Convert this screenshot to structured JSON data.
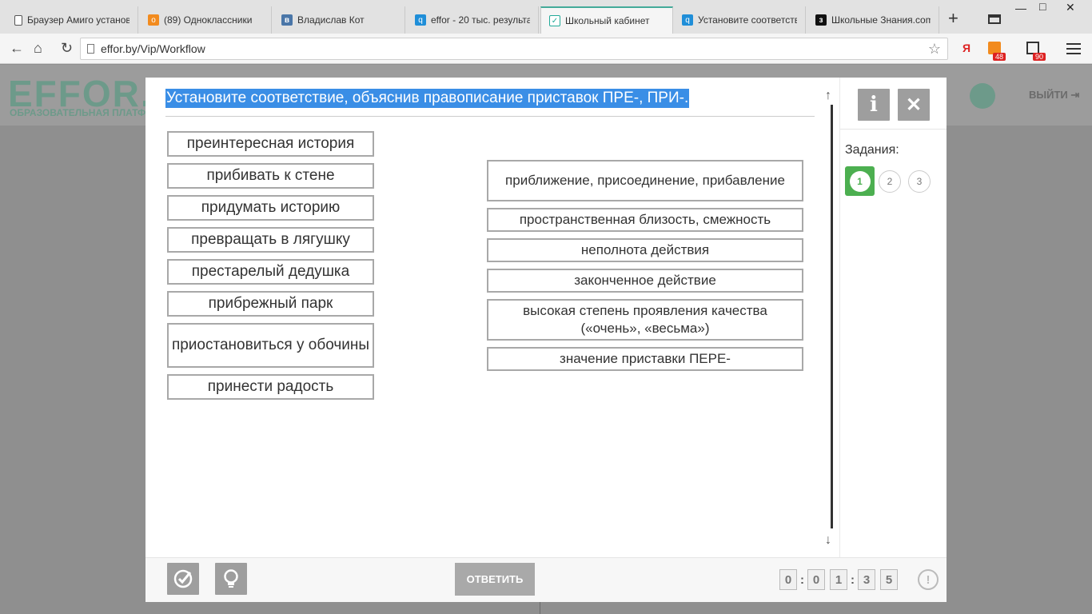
{
  "browser": {
    "tabs": [
      {
        "title": "Браузер Амиго установ",
        "icon": "document-icon"
      },
      {
        "title": "(89) Одноклассники",
        "icon": "odnoklassniki-icon"
      },
      {
        "title": "Владислав Кот",
        "icon": "vk-icon"
      },
      {
        "title": "effor - 20 тыс. результа",
        "icon": "search-icon"
      },
      {
        "title": "Школьный кабинет",
        "icon": "check-icon",
        "active": true
      },
      {
        "title": "Установите соответств",
        "icon": "search-icon"
      },
      {
        "title": "Школьные Знания.com",
        "icon": "znania-icon"
      }
    ],
    "new_tab": "+",
    "win_min": "—",
    "win_max": "□",
    "win_close": "✕",
    "url": "effor.by/Vip/Workflow",
    "ext_yandex": "Я",
    "ext_ok_badge": "48",
    "ext_news_badge": "90"
  },
  "site": {
    "logo": "EFFOR.BY",
    "subtitle": "ОБРАЗОВАТЕЛЬНАЯ ПЛАТФ",
    "logout": "ВЫЙТИ"
  },
  "question": {
    "title": "Установите соответствие, объяснив правописание приставок ПРЕ-, ПРИ-.",
    "left_items": [
      "преинтересная история",
      "прибивать к стене",
      "придумать историю",
      "превращать в лягушку",
      "престарелый дедушка",
      "прибрежный парк",
      "приостановиться у обочины",
      "принести радость"
    ],
    "right_items": [
      "приближение, присоединение, прибавление",
      "пространственная близость, смежность",
      "неполнота действия",
      "законченное действие",
      "высокая степень проявления качества («очень», «весьма»)",
      "значение приставки ПЕРЕ-"
    ]
  },
  "sidebar": {
    "info": "i",
    "close": "✕",
    "tasks_label": "Задания:",
    "tasks": [
      "1",
      "2",
      "3"
    ],
    "active_task": "1"
  },
  "footer": {
    "answer_label": "ОТВЕТИТЬ",
    "timer_digits": [
      "0",
      "0",
      "1",
      "3",
      "5"
    ],
    "timer_sep": ":",
    "warn": "!"
  },
  "colors": {
    "accent_green": "#4caf50",
    "selection_blue": "#3a8ee6",
    "button_gray": "#9e9e9e"
  }
}
